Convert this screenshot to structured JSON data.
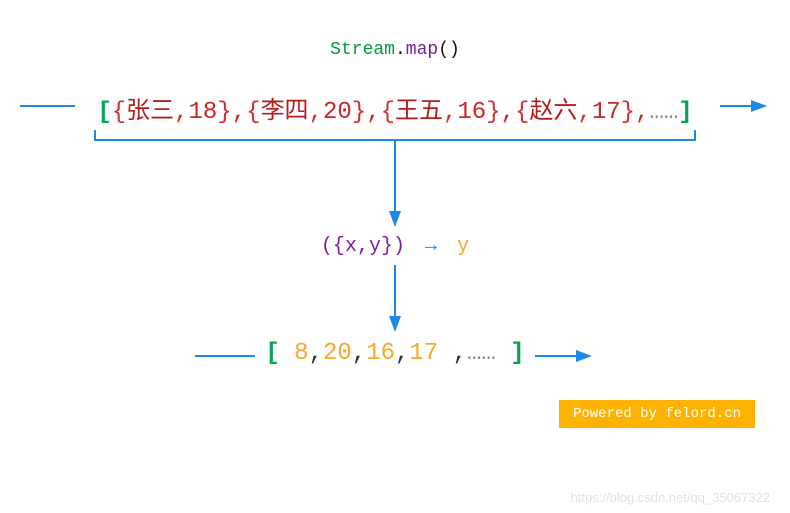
{
  "title": {
    "cls": "Stream",
    "dot": ".",
    "method": "map",
    "paren": "()"
  },
  "row1": {
    "open": "[",
    "close": "]",
    "items": [
      {
        "name": "张三",
        "age": "18"
      },
      {
        "name": "李四",
        "age": "20"
      },
      {
        "name": "王五",
        "age": "16"
      },
      {
        "name": "赵六",
        "age": "17"
      }
    ],
    "ellipsis": "……"
  },
  "lambda": {
    "open": "(",
    "inner_open": "{",
    "x": "x",
    "comma": ",",
    "y": "y",
    "inner_close": "}",
    "close": ")",
    "arrow": "→",
    "result": "y"
  },
  "row2": {
    "open": "[",
    "values": [
      "8",
      "20",
      "16",
      "17"
    ],
    "ellipsis": "……",
    "close": "]"
  },
  "badge": "Powered by felord.cn",
  "watermark": "https://blog.csdn.net/qq_35067322",
  "chart_data": {
    "type": "table",
    "description": "Diagram showing Java Stream.map() transforming a list of person objects to a list of ages via lambda ({x,y}) -> y",
    "input": [
      {
        "name": "张三",
        "age": 18
      },
      {
        "name": "李四",
        "age": 20
      },
      {
        "name": "王五",
        "age": 16
      },
      {
        "name": "赵六",
        "age": 17
      }
    ],
    "input_ellipsis": true,
    "lambda": "({x,y}) -> y",
    "output": [
      8,
      20,
      16,
      17
    ],
    "output_ellipsis": true,
    "output_note": "first value shown as 8 in image (likely truncated from 18)"
  }
}
